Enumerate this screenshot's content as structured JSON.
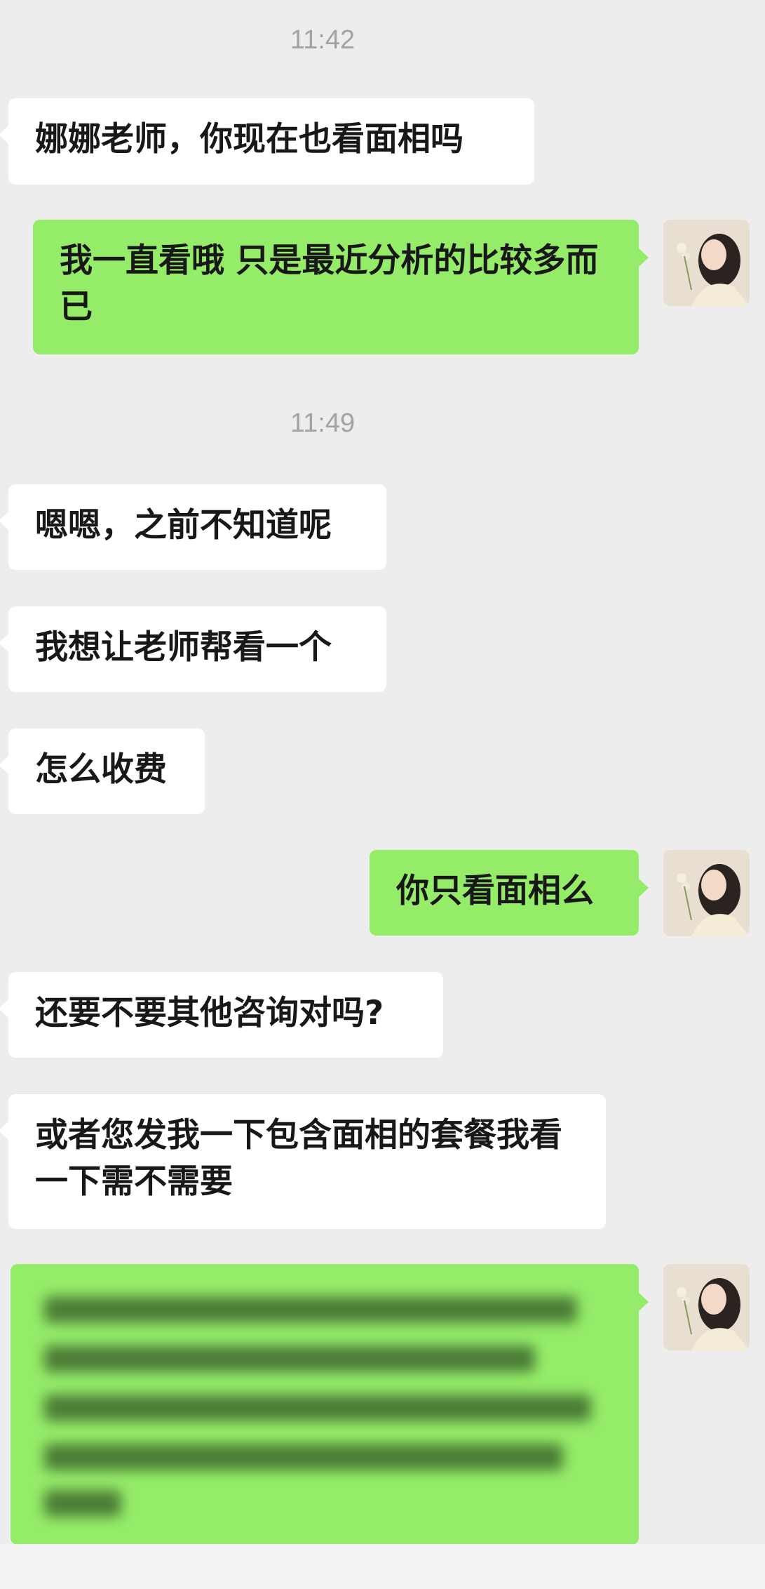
{
  "chat": {
    "messages": [
      {
        "type": "time",
        "text": "11:42"
      },
      {
        "type": "in",
        "text": "娜娜老师，你现在也看面相吗"
      },
      {
        "type": "out",
        "text": "我一直看哦 只是最近分析的比较多而已"
      },
      {
        "type": "time",
        "text": "11:49"
      },
      {
        "type": "in",
        "text": "嗯嗯，之前不知道呢"
      },
      {
        "type": "in",
        "text": "我想让老师帮看一个"
      },
      {
        "type": "in",
        "text": "怎么收费"
      },
      {
        "type": "out",
        "text": "你只看面相么"
      },
      {
        "type": "in",
        "text": "还要不要其他咨询对吗?"
      },
      {
        "type": "in",
        "text": "或者您发我一下包含面相的套餐我看一下需不需要"
      },
      {
        "type": "out",
        "text": "",
        "blurred": true
      }
    ]
  },
  "colors": {
    "background": "#ededed",
    "incoming_bubble": "#ffffff",
    "outgoing_bubble": "#95ec69",
    "timestamp": "#a3a3a3"
  },
  "icons": {
    "avatar": "avatar-woman-photo"
  }
}
